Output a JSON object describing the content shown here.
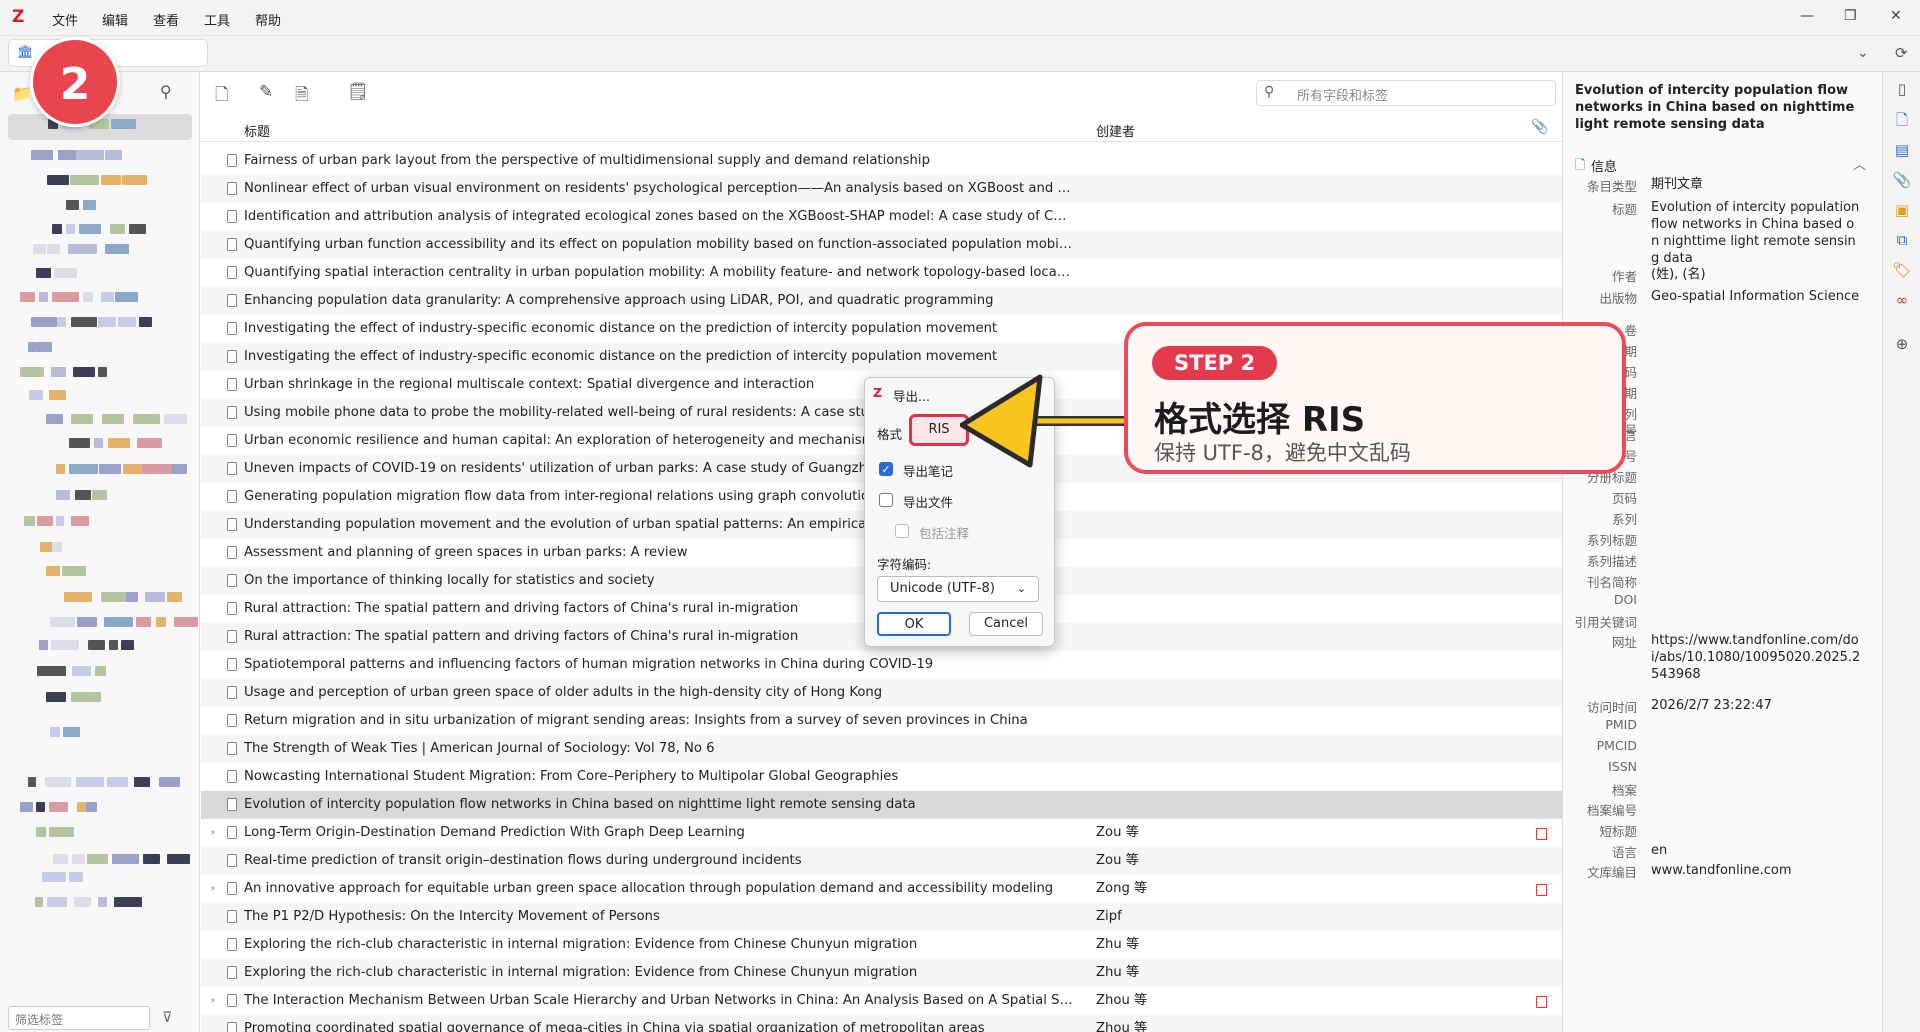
{
  "menu": [
    "文件",
    "编辑",
    "查看",
    "工具",
    "帮助"
  ],
  "search": {
    "placeholder": "所有字段和标签"
  },
  "left": {
    "filter_placeholder": "筛选标签"
  },
  "columns": {
    "title": "标题",
    "creator": "创建者"
  },
  "items": [
    {
      "title": "Fairness of urban park layout from the perspective of multidimensional supply and demand relationship",
      "creator": "",
      "expandable": false,
      "pdf": false
    },
    {
      "title": "Nonlinear effect of urban visual environment on residents' psychological perception——An analysis based on XGBoost and SHAP int...",
      "creator": "",
      "expandable": false,
      "pdf": false
    },
    {
      "title": "Identification and attribution analysis of integrated ecological zones based on the XGBoost-SHAP model: A case study of Chengdu, ...",
      "creator": "",
      "expandable": false,
      "pdf": false
    },
    {
      "title": "Quantifying urban function accessibility and its effect on population mobility based on function-associated population mobility net...",
      "creator": "",
      "expandable": false,
      "pdf": false
    },
    {
      "title": "Quantifying spatial interaction centrality in urban population mobility: A mobility feature- and network topology-based locational m...",
      "creator": "",
      "expandable": false,
      "pdf": false
    },
    {
      "title": "Enhancing population data granularity: A comprehensive approach using LiDAR, POI, and quadratic programming",
      "creator": "",
      "expandable": false,
      "pdf": false
    },
    {
      "title": "Investigating the effect of industry-specific economic distance on the prediction of intercity population movement",
      "creator": "",
      "expandable": false,
      "pdf": false
    },
    {
      "title": "Investigating the effect of industry-specific economic distance on the prediction of intercity population movement",
      "creator": "",
      "expandable": false,
      "pdf": false
    },
    {
      "title": "Urban shrinkage in the regional multiscale context: Spatial divergence and interaction",
      "creator": "",
      "expandable": false,
      "pdf": false
    },
    {
      "title": "Using mobile phone data to probe the mobility-related well-being of rural residents: A case study of",
      "creator": "",
      "expandable": false,
      "pdf": false
    },
    {
      "title": "Urban economic resilience and human capital: An exploration of heterogeneity and mechanism in th",
      "creator": "",
      "expandable": false,
      "pdf": false
    },
    {
      "title": "Uneven impacts of COVID-19 on residents' utilization of urban parks: A case study of Guangzhou, Ch",
      "creator": "",
      "expandable": false,
      "pdf": false
    },
    {
      "title": "Generating population migration flow data from inter-regional relations using graph convolutional",
      "creator": "",
      "expandable": false,
      "pdf": false
    },
    {
      "title": "Understanding population movement and the evolution of urban spatial patterns: An empirical stud",
      "creator": "",
      "expandable": false,
      "pdf": false
    },
    {
      "title": "Assessment and planning of green spaces in urban parks: A review",
      "creator": "",
      "expandable": false,
      "pdf": false
    },
    {
      "title": "On the importance of thinking locally for statistics and society",
      "creator": "",
      "expandable": false,
      "pdf": false
    },
    {
      "title": "Rural attraction: The spatial pattern and driving factors of China's rural in-migration",
      "creator": "",
      "expandable": false,
      "pdf": false
    },
    {
      "title": "Rural attraction: The spatial pattern and driving factors of China's rural in-migration",
      "creator": "",
      "expandable": false,
      "pdf": false
    },
    {
      "title": "Spatiotemporal patterns and influencing factors of human migration networks in China during COVID-19",
      "creator": "",
      "expandable": false,
      "pdf": false
    },
    {
      "title": "Usage and perception of urban green space of older adults in the high-density city of Hong Kong",
      "creator": "",
      "expandable": false,
      "pdf": false
    },
    {
      "title": "Return migration and in situ urbanization of migrant sending areas: Insights from a survey of seven provinces in China",
      "creator": "",
      "expandable": false,
      "pdf": false
    },
    {
      "title": "The Strength of Weak Ties | American Journal of Sociology: Vol 78, No 6",
      "creator": "",
      "expandable": false,
      "pdf": false
    },
    {
      "title": "Nowcasting International Student Migration: From Core–Periphery to Multipolar Global Geographies",
      "creator": "",
      "expandable": false,
      "pdf": false
    },
    {
      "title": "Evolution of intercity population flow networks in China based on nighttime light remote sensing data",
      "creator": "",
      "expandable": false,
      "pdf": false,
      "selected": true
    },
    {
      "title": "Long-Term Origin-Destination Demand Prediction With Graph Deep Learning",
      "creator": "Zou 等",
      "expandable": true,
      "pdf": true
    },
    {
      "title": "Real-time prediction of transit origin–destination flows during underground incidents",
      "creator": "Zou 等",
      "expandable": false,
      "pdf": false
    },
    {
      "title": "An innovative approach for equitable urban green space allocation through population demand and accessibility modeling",
      "creator": "Zong 等",
      "expandable": true,
      "pdf": true
    },
    {
      "title": "The P1 P2/D Hypothesis: On the Intercity Movement of Persons",
      "creator": "Zipf",
      "expandable": false,
      "pdf": false
    },
    {
      "title": "Exploring the rich-club characteristic in internal migration: Evidence from Chinese Chunyun migration",
      "creator": "Zhu 等",
      "expandable": false,
      "pdf": false
    },
    {
      "title": "Exploring the rich-club characteristic in internal migration: Evidence from Chinese Chunyun migration",
      "creator": "Zhu 等",
      "expandable": false,
      "pdf": false
    },
    {
      "title": "The Interaction Mechanism Between Urban Scale Hierarchy and Urban Networks in China: An Analysis Based on A Spatial Simultane...",
      "creator": "Zhou 等",
      "expandable": true,
      "pdf": true
    },
    {
      "title": "Promoting coordinated spatial governance of mega-cities in China via spatial organization of metropolitan areas",
      "creator": "Zhou 等",
      "expandable": false,
      "pdf": false
    }
  ],
  "right": {
    "title": "Evolution of intercity population flow networks in China based on nighttime light remote sensing data",
    "section": "信息",
    "fields": [
      {
        "label": "条目类型",
        "value": "期刊文章"
      },
      {
        "label": "标题",
        "value": "Evolution of intercity population flow networks in China based on nighttime light remote sensing data"
      },
      {
        "label": "作者",
        "value": "(姓), (名)"
      },
      {
        "label": "出版物",
        "value": "Geo-spatial Information Science"
      },
      {
        "label": "卷",
        "value": ""
      },
      {
        "label": "期",
        "value": ""
      },
      {
        "label": "页码",
        "value": ""
      },
      {
        "label": "日期",
        "value": ""
      },
      {
        "label": "系列",
        "value": ""
      },
      {
        "label": "语言",
        "value": ""
      },
      {
        "label": "条文序号",
        "value": ""
      },
      {
        "label": "分册号",
        "value": ""
      },
      {
        "label": "分册标题",
        "value": ""
      },
      {
        "label": "页码",
        "value": ""
      },
      {
        "label": "系列",
        "value": ""
      },
      {
        "label": "系列标题",
        "value": ""
      },
      {
        "label": "系列描述",
        "value": ""
      },
      {
        "label": "刊名简称",
        "value": ""
      },
      {
        "label": "DOI",
        "value": ""
      },
      {
        "label": "引用关键词",
        "value": ""
      },
      {
        "label": "网址",
        "value": "https://www.tandfonline.com/doi/abs/10.1080/10095020.2025.2543968"
      },
      {
        "label": "访问时间",
        "value": "2026/2/7 23:22:47"
      },
      {
        "label": "PMID",
        "value": ""
      },
      {
        "label": "PMCID",
        "value": ""
      },
      {
        "label": "ISSN",
        "value": ""
      },
      {
        "label": "档案",
        "value": ""
      },
      {
        "label": "档案编号",
        "value": ""
      },
      {
        "label": "短标题",
        "value": ""
      },
      {
        "label": "语言",
        "value": "en"
      },
      {
        "label": "文库编目",
        "value": "www.tandfonline.com"
      }
    ]
  },
  "dialog": {
    "title": "导出...",
    "format_label": "格式",
    "format_value": "RIS",
    "export_notes": "导出笔记",
    "export_files": "导出文件",
    "include_annotations": "包括注释",
    "encoding_label": "字符编码:",
    "encoding_value": "Unicode (UTF-8)",
    "ok": "OK",
    "cancel": "Cancel"
  },
  "annotation": {
    "step_number": "2",
    "step_pill": "STEP 2",
    "headline": "格式选择 RIS",
    "subline": "保持 UTF-8，避免中文乱码",
    "badge_color": "#e8454f",
    "arrow_color": "#f7c51e"
  }
}
